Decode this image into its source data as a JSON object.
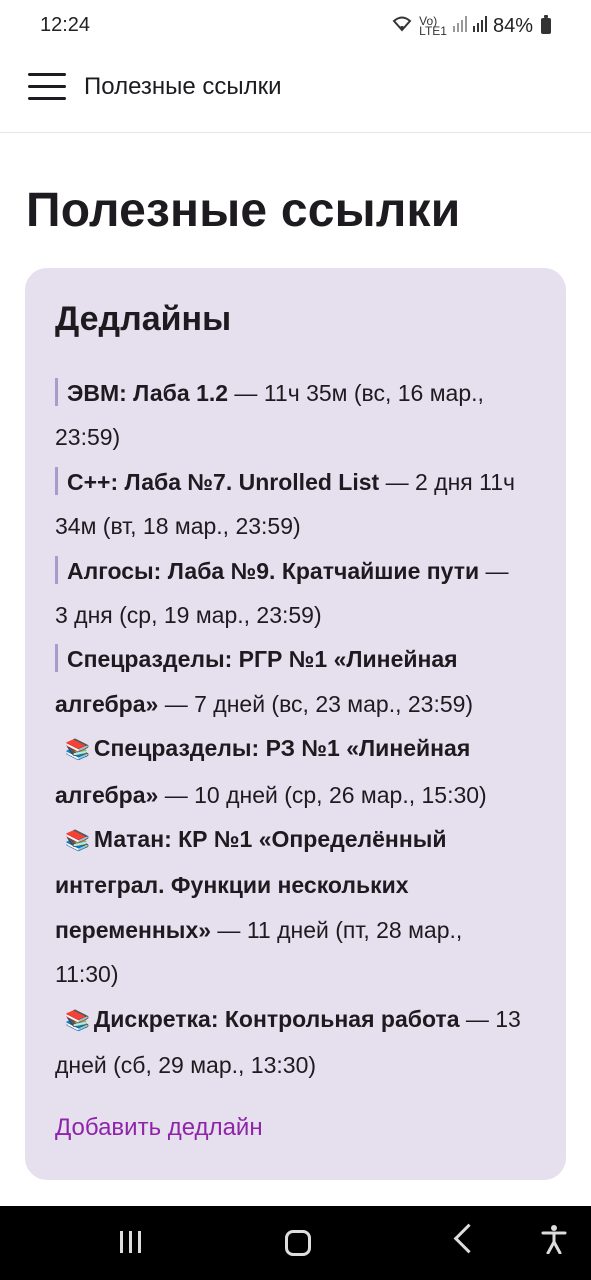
{
  "status": {
    "time": "12:24",
    "battery": "84%",
    "icons": [
      "wifi-icon",
      "volte-icon",
      "signal-icon",
      "signal-icon",
      "battery-icon"
    ]
  },
  "app_bar": {
    "title": "Полезные ссылки",
    "menu_icon": "hamburger-menu-icon"
  },
  "page": {
    "title": "Полезные ссылки"
  },
  "deadlines_card": {
    "title": "Дедлайны",
    "items": [
      {
        "marker": "bar",
        "name": "ЭВМ: Лаба 1.2",
        "rest": " — 11ч 35м (вс, 16 мар., 23:59)"
      },
      {
        "marker": "bar",
        "name": "C++: Лаба №7. Unrolled List",
        "rest": " — 2 дня 11ч 34м (вт, 18 мар., 23:59)"
      },
      {
        "marker": "bar",
        "name": "Алгосы: Лаба №9. Кратчайшие пути",
        "rest": " — 3 дня (ср, 19 мар., 23:59)"
      },
      {
        "marker": "bar",
        "name": "Спецразделы: РГР №1 «Линейная алгебра»",
        "rest": " — 7 дней (вс, 23 мар., 23:59)"
      },
      {
        "marker": "📚",
        "name": "Спецразделы: РЗ №1 «Линейная алгебра»",
        "rest": " — 10 дней (ср, 26 мар., 15:30)"
      },
      {
        "marker": "📚",
        "name": "Матан: КР №1 «Определённый интеграл. Функции нескольких переменных»",
        "rest": " — 11 дней (пт, 28 мар., 11:30)"
      },
      {
        "marker": "📚",
        "name": "Дискретка: Контрольная работа",
        "rest": " — 13 дней (сб, 29 мар., 13:30)"
      }
    ],
    "add_link": "Добавить дедлайн",
    "link_color": "#8e24aa"
  },
  "nav": {
    "icons": [
      "recent-apps-icon",
      "home-icon",
      "back-icon",
      "accessibility-icon"
    ]
  }
}
